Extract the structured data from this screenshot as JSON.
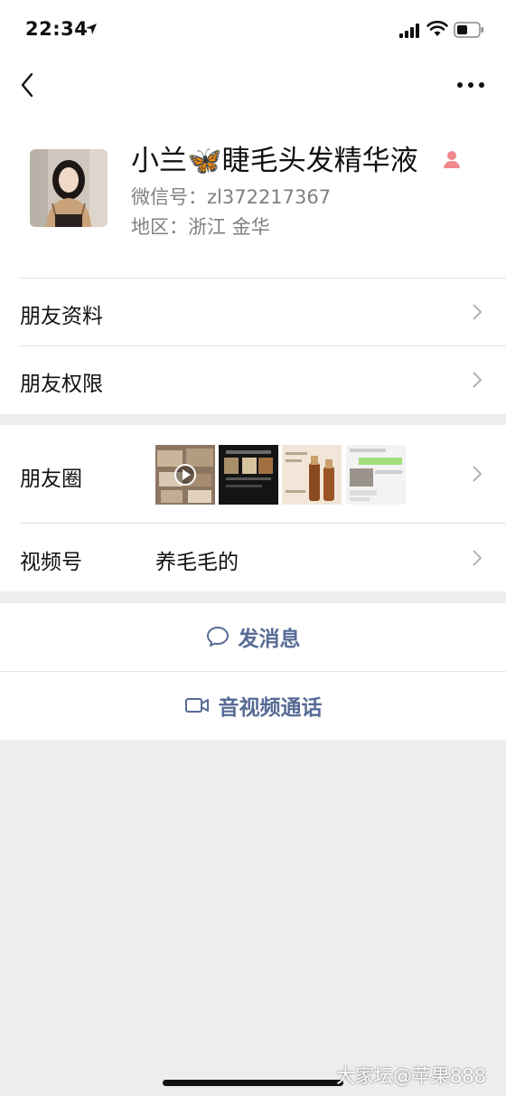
{
  "status_bar": {
    "time": "22:34"
  },
  "profile": {
    "name": "小兰🦋睫毛头发精华液",
    "wechat_id": "微信号：zl372217367",
    "region": "地区：浙江  金华"
  },
  "rows": {
    "friend_info": "朋友资料",
    "friend_permissions": "朋友权限",
    "moments": "朋友圈",
    "channels_label": "视频号",
    "channels_value": "养毛毛的"
  },
  "actions": {
    "send_message": "发消息",
    "av_call": "音视频通话"
  },
  "icons": {
    "back": "chevron-left-icon",
    "more": "more-dots-icon",
    "gender": "female-icon",
    "message": "chat-bubble-icon",
    "video": "video-camera-icon"
  },
  "colors": {
    "link": "#576b95",
    "gender": "#f0888d",
    "background": "#ededed"
  },
  "watermark": "大家坛@苹果888"
}
